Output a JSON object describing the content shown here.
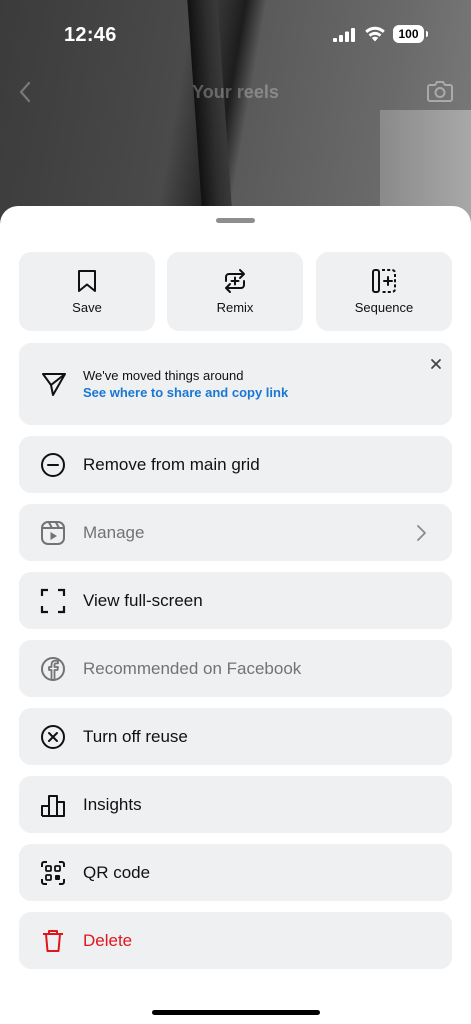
{
  "status_bar": {
    "time": "12:46",
    "battery": "100"
  },
  "header": {
    "title": "Your reels"
  },
  "actions": [
    {
      "label": "Save",
      "icon": "bookmark-icon"
    },
    {
      "label": "Remix",
      "icon": "remix-icon"
    },
    {
      "label": "Sequence",
      "icon": "sequence-icon"
    }
  ],
  "notice": {
    "text": "We've moved things around",
    "link": "See where to share and copy link",
    "icon": "send-icon"
  },
  "menu": [
    {
      "label": "Remove from main grid",
      "icon": "minus-circle-icon",
      "state": "enabled"
    },
    {
      "label": "Manage",
      "icon": "reels-icon",
      "state": "disabled"
    },
    {
      "label": "View full-screen",
      "icon": "fullscreen-icon",
      "state": "enabled"
    },
    {
      "label": "Recommended on Facebook",
      "icon": "facebook-icon",
      "state": "disabled"
    },
    {
      "label": "Turn off reuse",
      "icon": "x-circle-icon",
      "state": "enabled"
    },
    {
      "label": "Insights",
      "icon": "bar-chart-icon",
      "state": "enabled"
    },
    {
      "label": "QR code",
      "icon": "qr-code-icon",
      "state": "enabled"
    },
    {
      "label": "Delete",
      "icon": "trash-icon",
      "state": "destructive"
    }
  ],
  "colors": {
    "link": "#1a77d2",
    "danger": "#e0161d",
    "surface": "#eff0f2"
  }
}
